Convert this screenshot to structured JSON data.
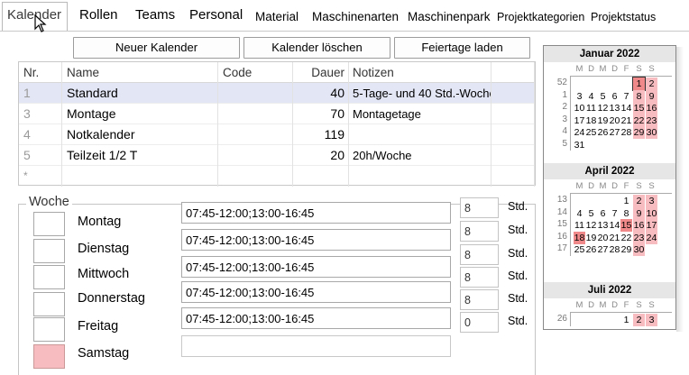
{
  "tabs": [
    "Kalender",
    "Rollen",
    "Teams",
    "Personal",
    "Material",
    "Maschinenarten",
    "Maschinenpark",
    "Projektkategorien",
    "Projektstatus"
  ],
  "toolbar": {
    "new_label": "Neuer Kalender",
    "delete_label": "Kalender löschen",
    "holidays_label": "Feiertage laden"
  },
  "grid": {
    "headers": {
      "nr": "Nr.",
      "name": "Name",
      "code": "Code",
      "dauer": "Dauer",
      "notizen": "Notizen"
    },
    "rows": [
      {
        "nr": "1",
        "name": "Standard",
        "code": "",
        "dauer": "40",
        "notizen": "5-Tage- und 40 Std.-Woche"
      },
      {
        "nr": "3",
        "name": "Montage",
        "code": "",
        "dauer": "70",
        "notizen": "Montagetage"
      },
      {
        "nr": "4",
        "name": "Notkalender",
        "code": "",
        "dauer": "119",
        "notizen": ""
      },
      {
        "nr": "5",
        "name": "Teilzeit 1/2 T",
        "code": "",
        "dauer": "20",
        "notizen": "20h/Woche"
      }
    ],
    "new_row_marker": "*"
  },
  "woche": {
    "label": "Woche",
    "unit": "Std.",
    "days": [
      {
        "name": "Montag",
        "times": "07:45-12:00;13:00-16:45",
        "hours": "8"
      },
      {
        "name": "Dienstag",
        "times": "07:45-12:00;13:00-16:45",
        "hours": "8"
      },
      {
        "name": "Mittwoch",
        "times": "07:45-12:00;13:00-16:45",
        "hours": "8"
      },
      {
        "name": "Donnerstag",
        "times": "07:45-12:00;13:00-16:45",
        "hours": "8"
      },
      {
        "name": "Freitag",
        "times": "07:45-12:00;13:00-16:45",
        "hours": "0"
      },
      {
        "name": "Samstag",
        "times": "",
        "hours": ""
      }
    ]
  },
  "calendar": {
    "nav_prev": "◄",
    "weekdays": [
      "M",
      "D",
      "M",
      "D",
      "F",
      "S",
      "S"
    ],
    "months": [
      {
        "title": "Januar 2022",
        "weeks": [
          {
            "wk": "52",
            "days": [
              "",
              "",
              "",
              "",
              "",
              "1",
              "2"
            ]
          },
          {
            "wk": "1",
            "days": [
              "3",
              "4",
              "5",
              "6",
              "7",
              "8",
              "9"
            ]
          },
          {
            "wk": "2",
            "days": [
              "10",
              "11",
              "12",
              "13",
              "14",
              "15",
              "16"
            ]
          },
          {
            "wk": "3",
            "days": [
              "17",
              "18",
              "19",
              "20",
              "21",
              "22",
              "23"
            ]
          },
          {
            "wk": "4",
            "days": [
              "24",
              "25",
              "26",
              "27",
              "28",
              "29",
              "30"
            ]
          },
          {
            "wk": "5",
            "days": [
              "31",
              "",
              "",
              "",
              "",
              "",
              ""
            ]
          }
        ]
      },
      {
        "title": "April 2022",
        "weeks": [
          {
            "wk": "13",
            "days": [
              "",
              "",
              "",
              "",
              "1",
              "2",
              "3"
            ]
          },
          {
            "wk": "14",
            "days": [
              "4",
              "5",
              "6",
              "7",
              "8",
              "9",
              "10"
            ]
          },
          {
            "wk": "15",
            "days": [
              "11",
              "12",
              "13",
              "14",
              "15",
              "16",
              "17"
            ]
          },
          {
            "wk": "16",
            "days": [
              "18",
              "19",
              "20",
              "21",
              "22",
              "23",
              "24"
            ]
          },
          {
            "wk": "17",
            "days": [
              "25",
              "26",
              "27",
              "28",
              "29",
              "30",
              ""
            ]
          }
        ]
      },
      {
        "title": "Juli 2022",
        "weeks": [
          {
            "wk": "26",
            "days": [
              "",
              "",
              "",
              "",
              "1",
              "2",
              "3"
            ]
          }
        ]
      }
    ],
    "colors": {
      "weekend": "#f7bcc0",
      "holiday": "#f08a8a",
      "selected_row": "#e3e6f5"
    }
  }
}
